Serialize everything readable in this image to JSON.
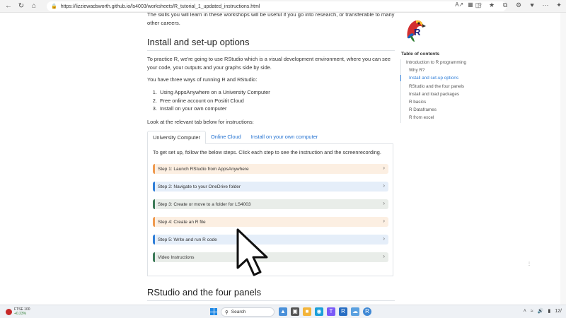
{
  "browser": {
    "url": "https://lizziewadsworth.github.io/ls4003/worksheets/R_tutorial_1_updated_instructions.html",
    "nav_icons": [
      "back-arrow-icon",
      "refresh-icon",
      "home-icon"
    ]
  },
  "content": {
    "intro_text": "The skills you will learn in these workshops will be useful if you go into research, or transferable to many other careers.",
    "install_heading": "Install and set-up options",
    "install_para1": "To practice R, we're going to use RStudio which is a visual development environment, where you can see your code, your outputs and your graphs side by side.",
    "install_para2": "You have three ways of running R and RStudio:",
    "options": [
      "Using AppsAnywhere on a University Computer",
      "Free online account on Positit Cloud",
      "Install on your own computer"
    ],
    "tab_instruction": "Look at the relevant tab below for instructions:",
    "tabs": [
      "University Computer",
      "Online Cloud",
      "Install on your own computer"
    ],
    "panel_text": "To get set up, follow the below steps. Click each step to see the instruction and the screenrecording.",
    "steps": [
      {
        "label": "Step 1: Launch RStudio from AppsAnywhere",
        "color": "orange"
      },
      {
        "label": "Step 2: Navigate to your OneDrive folder",
        "color": "blue"
      },
      {
        "label": "Step 3: Create or move to a folder for LS4003",
        "color": "green"
      },
      {
        "label": "Step 4: Create an R file",
        "color": "orange"
      },
      {
        "label": "Step 5: Write and run R code",
        "color": "blue"
      },
      {
        "label": "Video Instructions",
        "color": "green"
      }
    ],
    "next_heading": "RStudio and the four panels"
  },
  "sidebar": {
    "toc_title": "Table of contents",
    "items": [
      {
        "label": "Introduction to R programming",
        "level": 1,
        "active": false
      },
      {
        "label": "Why R?",
        "level": 2,
        "active": false
      },
      {
        "label": "Install and set-up options",
        "level": 2,
        "active": true
      },
      {
        "label": "RStudio and the four panels",
        "level": 2,
        "active": false
      },
      {
        "label": "Install and load packages",
        "level": 2,
        "active": false
      },
      {
        "label": "R basics",
        "level": 2,
        "active": false
      },
      {
        "label": "R Dataframes",
        "level": 2,
        "active": false
      },
      {
        "label": "R from excel",
        "level": 2,
        "active": false
      }
    ]
  },
  "taskbar": {
    "ticker_name": "FTSE 100",
    "ticker_change": "+0.23%",
    "search_label": "Search",
    "clock": "12/"
  },
  "colors": {
    "link": "#1f6fd0",
    "step_orange": "#ef9a4f",
    "step_blue": "#2f7ed8",
    "step_green": "#3b7a57"
  }
}
